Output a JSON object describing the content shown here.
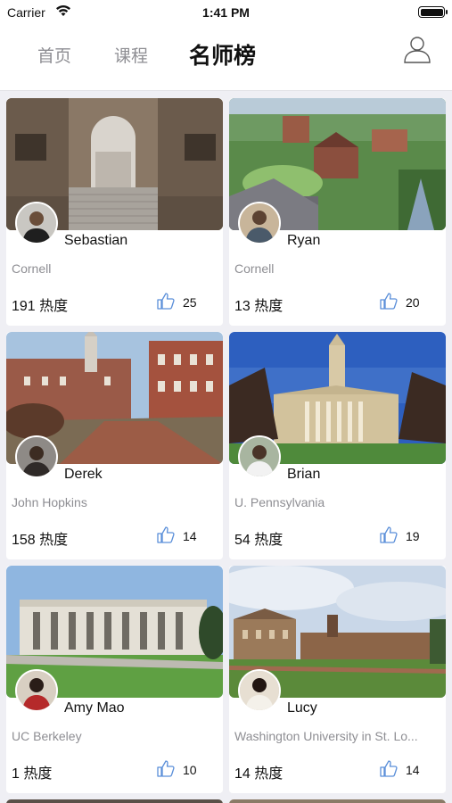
{
  "status_bar": {
    "carrier": "Carrier",
    "time": "1:41 PM"
  },
  "nav": {
    "tabs": [
      {
        "label": "首页",
        "active": false
      },
      {
        "label": "课程",
        "active": false
      },
      {
        "label": "名师榜",
        "active": true
      }
    ],
    "profile_icon": "user-icon"
  },
  "colors": {
    "accent": "#5b8fd9",
    "background": "#efeff4",
    "secondary_text": "#8e8e93"
  },
  "teachers": [
    {
      "name": "Sebastian",
      "school": "Cornell",
      "heat": "191 热度",
      "likes": "25"
    },
    {
      "name": "Ryan",
      "school": "Cornell",
      "heat": "13 热度",
      "likes": "20"
    },
    {
      "name": "Derek",
      "school": "John Hopkins",
      "heat": "158 热度",
      "likes": "14"
    },
    {
      "name": "Brian",
      "school": "U. Pennsylvania",
      "heat": "54 热度",
      "likes": "19"
    },
    {
      "name": "Amy Mao",
      "school": "UC Berkeley",
      "heat": "1 热度",
      "likes": "10"
    },
    {
      "name": "Lucy",
      "school": "Washington University in St. Lo...",
      "heat": "14 热度",
      "likes": "14"
    }
  ]
}
